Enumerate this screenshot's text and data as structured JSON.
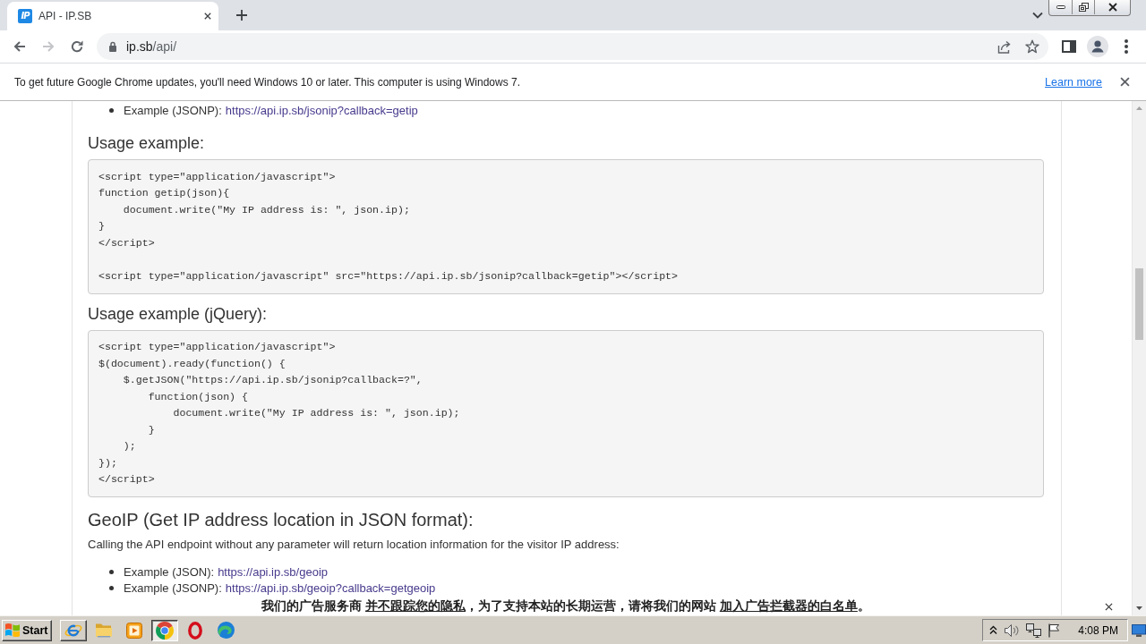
{
  "browser": {
    "tab": {
      "logo_text": "IP",
      "title": "API - IP.SB",
      "selected": true
    },
    "navigation": [
      {
        "kind": "back",
        "disabled": false
      },
      {
        "kind": "forward",
        "disabled": true
      },
      {
        "kind": "reload",
        "disabled": false
      }
    ],
    "address": {
      "host": "ip.sb",
      "path": "/api/"
    }
  },
  "infobar": {
    "message": "To get future Google Chrome updates, you'll need Windows 10 or later. This computer is using Windows 7.",
    "link": "Learn more"
  },
  "page": {
    "blocks": [
      {
        "kind": "list",
        "items": [
          {
            "label": "Example (JSONP):",
            "link": "https://api.ip.sb/jsonip?callback=getip"
          }
        ]
      },
      {
        "kind": "subheading",
        "text": "Usage example:"
      },
      {
        "kind": "code",
        "text": "<script type=\"application/javascript\">\nfunction getip(json){\n    document.write(\"My IP address is: \", json.ip);\n}\n</script>\n\n<script type=\"application/javascript\" src=\"https://api.ip.sb/jsonip?callback=getip\"></script>"
      },
      {
        "kind": "subheading",
        "text": "Usage example (jQuery):"
      },
      {
        "kind": "code",
        "text": "<script type=\"application/javascript\">\n$(document).ready(function() {\n    $.getJSON(\"https://api.ip.sb/jsonip?callback=?\",\n        function(json) {\n            document.write(\"My IP address is: \", json.ip);\n        }\n    );\n});\n</script>"
      },
      {
        "kind": "heading",
        "text": "GeoIP (Get IP address location in JSON format):"
      },
      {
        "kind": "paragraph",
        "text": "Calling the API endpoint without any parameter will return location information for the visitor IP address:"
      },
      {
        "kind": "list",
        "items": [
          {
            "label": "Example (JSON):",
            "link": "https://api.ip.sb/geoip"
          },
          {
            "label": "Example (JSONP):",
            "link": "https://api.ip.sb/geoip?callback=getgeoip"
          }
        ]
      }
    ]
  },
  "ad_notice": {
    "parts": [
      {
        "kind": "text",
        "text": "我们的广告服务商 "
      },
      {
        "kind": "link",
        "text": "并不跟踪您的隐私"
      },
      {
        "kind": "text",
        "text": "，为了支持本站的长期运营，请将我们的网站 "
      },
      {
        "kind": "link",
        "text": "加入广告拦截器的白名单"
      },
      {
        "kind": "text",
        "text": "。"
      }
    ]
  },
  "taskbar": {
    "start": "Start",
    "apps": [
      {
        "kind": "e-logo",
        "open": true,
        "selected": false
      },
      {
        "kind": "folder",
        "open": false,
        "selected": false
      },
      {
        "kind": "player",
        "open": false,
        "selected": false
      },
      {
        "kind": "ring-logo",
        "open": true,
        "selected": true
      },
      {
        "kind": "o-logo",
        "open": false,
        "selected": false
      },
      {
        "kind": "wave-logo",
        "open": false,
        "selected": false
      }
    ],
    "clock": "4:08 PM"
  }
}
